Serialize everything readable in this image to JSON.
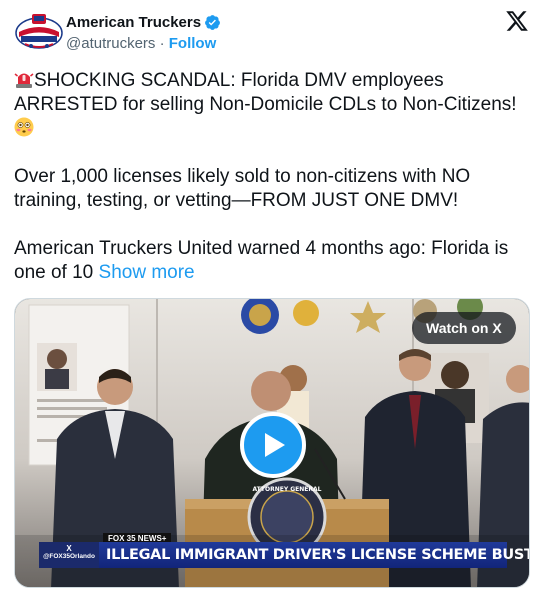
{
  "author": {
    "name": "American Truckers",
    "handle": "@atutruckers",
    "separator": "·",
    "follow_label": "Follow",
    "avatar_icon": "american-truckers-united-logo",
    "verified_icon": "verified-badge-icon",
    "verified_color": "#1d9bf0"
  },
  "platform_icon": "x-logo-icon",
  "tweet": {
    "p1_emoji": "police-light-emoji",
    "p1_text": "SHOCKING SCANDAL: Florida DMV employees ARRESTED for selling Non-Domicile CDLs to Non-Citizens!",
    "p1_end_emoji": "flushed-face-emoji",
    "p2_text": "Over 1,000 licenses likely sold to non-citizens with NO training, testing, or vetting—FROM JUST ONE DMV!",
    "p3_text": "American Truckers United warned 4 months ago: Florida is one of 10",
    "show_more_label": "Show more"
  },
  "media": {
    "watch_label": "Watch on X",
    "play_icon": "play-icon",
    "news_tag": "FOX 35 NEWS+",
    "channel_handle": "@FOX35Orlando",
    "channel_x": "X",
    "headline": "ILLEGAL IMMIGRANT DRIVER'S LICENSE SCHEME BUSTED",
    "seal_text": "ATTORNEY GENERAL"
  },
  "colors": {
    "link": "#1d9bf0",
    "text": "#0f1419",
    "secondary": "#536471",
    "lower_third": "#1a2f8a"
  }
}
